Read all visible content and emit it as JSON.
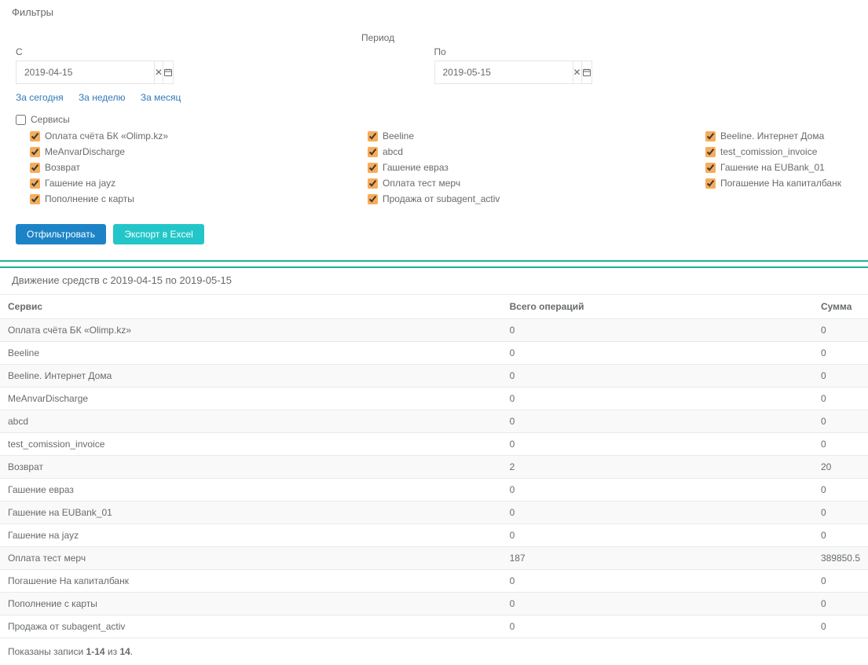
{
  "filters": {
    "heading": "Фильтры",
    "period_label": "Период",
    "from_label": "С",
    "to_label": "По",
    "from_value": "2019-04-15",
    "to_value": "2019-05-15",
    "quick": {
      "today": "За сегодня",
      "week": "За неделю",
      "month": "За месяц"
    },
    "services_label": "Сервисы",
    "services_col1": [
      "Оплата счёта БК «Olimp.kz»",
      "MeAnvarDischarge",
      "Возврат",
      "Гашение на jayz",
      "Пополнение с карты"
    ],
    "services_col2": [
      "Beeline",
      "abcd",
      "Гашение евраз",
      "Оплата тест мерч",
      "Продажа от subagent_activ"
    ],
    "services_col3": [
      "Beeline. Интернет Дома",
      "test_comission_invoice",
      "Гашение на EUBank_01",
      "Погашение На капиталбанк"
    ],
    "filter_button": "Отфильтровать",
    "export_button": "Экспорт в Excel"
  },
  "report": {
    "heading": "Движение средств с 2019-04-15 по 2019-05-15",
    "columns": {
      "service": "Сервис",
      "ops": "Всего операций",
      "sum": "Сумма"
    },
    "rows": [
      {
        "service": "Оплата счёта БК «Olimp.kz»",
        "ops": "0",
        "sum": "0"
      },
      {
        "service": "Beeline",
        "ops": "0",
        "sum": "0"
      },
      {
        "service": "Beeline. Интернет Дома",
        "ops": "0",
        "sum": "0"
      },
      {
        "service": "MeAnvarDischarge",
        "ops": "0",
        "sum": "0"
      },
      {
        "service": "abcd",
        "ops": "0",
        "sum": "0"
      },
      {
        "service": "test_comission_invoice",
        "ops": "0",
        "sum": "0"
      },
      {
        "service": "Возврат",
        "ops": "2",
        "sum": "20"
      },
      {
        "service": "Гашение евраз",
        "ops": "0",
        "sum": "0"
      },
      {
        "service": "Гашение на EUBank_01",
        "ops": "0",
        "sum": "0"
      },
      {
        "service": "Гашение на jayz",
        "ops": "0",
        "sum": "0"
      },
      {
        "service": "Оплата тест мерч",
        "ops": "187",
        "sum": "389850.5"
      },
      {
        "service": "Погашение На капиталбанк",
        "ops": "0",
        "sum": "0"
      },
      {
        "service": "Пополнение с карты",
        "ops": "0",
        "sum": "0"
      },
      {
        "service": "Продажа от subagent_activ",
        "ops": "0",
        "sum": "0"
      }
    ],
    "pager_prefix": "Показаны записи ",
    "pager_range": "1-14",
    "pager_middle": " из ",
    "pager_total": "14",
    "pager_suffix": "."
  }
}
